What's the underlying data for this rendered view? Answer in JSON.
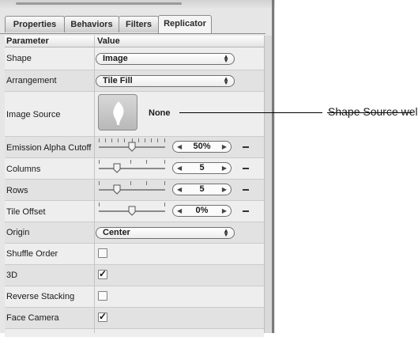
{
  "tabs": [
    "Properties",
    "Behaviors",
    "Filters",
    "Replicator"
  ],
  "active_tab": "Replicator",
  "header": {
    "parameter": "Parameter",
    "value": "Value"
  },
  "rows": {
    "shape": {
      "label": "Shape",
      "value": "Image"
    },
    "arrangement": {
      "label": "Arrangement",
      "value": "Tile Fill"
    },
    "image_source": {
      "label": "Image Source",
      "value": "None"
    },
    "emission_alpha": {
      "label": "Emission Alpha Cutoff",
      "value": "50%"
    },
    "columns": {
      "label": "Columns",
      "value": "5"
    },
    "rows": {
      "label": "Rows",
      "value": "5"
    },
    "tile_offset": {
      "label": "Tile Offset",
      "value": "0%"
    },
    "origin": {
      "label": "Origin",
      "value": "Center"
    },
    "shuffle_order": {
      "label": "Shuffle Order",
      "checked": false
    },
    "three_d": {
      "label": "3D",
      "checked": true
    },
    "reverse_stacking": {
      "label": "Reverse Stacking",
      "checked": false
    },
    "face_camera": {
      "label": "Face Camera",
      "checked": true
    }
  },
  "callout": "Shape Source well"
}
